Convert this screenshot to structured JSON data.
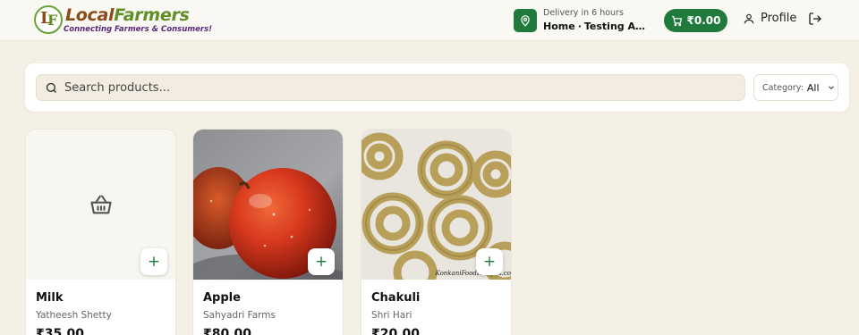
{
  "header": {
    "logo": {
      "name_part1": "Local",
      "name_part2": "Farmers",
      "tagline": "Connecting Farmers & Consumers!",
      "mark": "LF"
    },
    "delivery": {
      "eta": "Delivery in 6 hours",
      "label": "Home",
      "address": "Testing Addre..."
    },
    "cart": {
      "amount": "₹0.00"
    },
    "profile_label": "Profile"
  },
  "search": {
    "placeholder": "Search products...",
    "value": ""
  },
  "category": {
    "label": "Category:",
    "selected": "All"
  },
  "products": [
    {
      "name": "Milk",
      "seller": "Yatheesh Shetty",
      "price": "₹35.00",
      "image": "basket-icon"
    },
    {
      "name": "Apple",
      "seller": "Sahyadri Farms",
      "price": "₹80.00",
      "image": "apple-photo"
    },
    {
      "name": "Chakuli",
      "seller": "Shri Hari",
      "price": "₹20.00",
      "image": "chakuli-photo",
      "watermark": "KonkaniFoodRecipes.co"
    }
  ],
  "colors": {
    "brand_green": "#1f7a3c",
    "background": "#f4f0e6"
  }
}
